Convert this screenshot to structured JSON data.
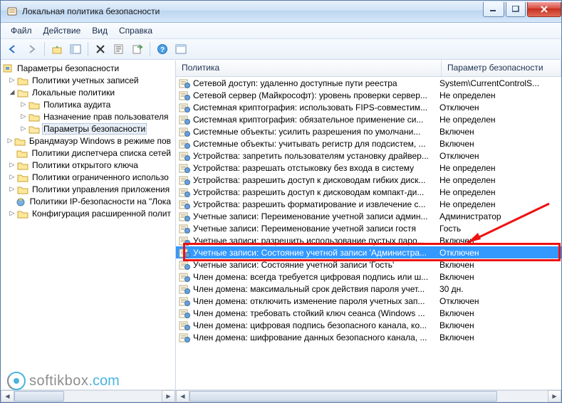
{
  "window": {
    "title": "Локальная политика безопасности"
  },
  "menu": {
    "file": "Файл",
    "action": "Действие",
    "view": "Вид",
    "help": "Справка"
  },
  "tree": {
    "root": "Параметры безопасности",
    "n1": "Политики учетных записей",
    "n2": "Локальные политики",
    "n2a": "Политика аудита",
    "n2b": "Назначение прав пользователя",
    "n2c": "Параметры безопасности",
    "n3": "Брандмауэр Windows в режиме пов",
    "n4": "Политики диспетчера списка сетей",
    "n5": "Политики открытого ключа",
    "n6": "Политики ограниченного использо",
    "n7": "Политики управления приложения",
    "n8": "Политики IP-безопасности на \"Лока",
    "n9": "Конфигурация расширенной полит"
  },
  "columns": {
    "policy": "Политика",
    "setting": "Параметр безопасности"
  },
  "rows": [
    {
      "p": "Сетевой доступ: удаленно доступные пути реестра",
      "s": "System\\CurrentControlS..."
    },
    {
      "p": "Сетевой сервер (Майкрософт): уровень проверки сервер...",
      "s": "Не определен"
    },
    {
      "p": "Системная криптография: использовать FIPS-совместим...",
      "s": "Отключен"
    },
    {
      "p": "Системная криптография: обязательное применение си...",
      "s": "Не определен"
    },
    {
      "p": "Системные объекты: усилить разрешения по умолчани...",
      "s": "Включен"
    },
    {
      "p": "Системные объекты: учитывать регистр для подсистем, ...",
      "s": "Включен"
    },
    {
      "p": "Устройства: запретить пользователям установку драйвер...",
      "s": "Отключен"
    },
    {
      "p": "Устройства: разрешать отстыковку без входа в систему",
      "s": "Не определен"
    },
    {
      "p": "Устройства: разрешить доступ к дисководам гибких диск...",
      "s": "Не определен"
    },
    {
      "p": "Устройства: разрешить доступ к дисководам компакт-ди...",
      "s": "Не определен"
    },
    {
      "p": "Устройства: разрешить форматирование и извлечение с...",
      "s": "Не определен"
    },
    {
      "p": "Учетные записи: Переименование учетной записи админ...",
      "s": "Администратор"
    },
    {
      "p": "Учетные записи: Переименование учетной записи гостя",
      "s": "Гость"
    },
    {
      "p": "Учетные записи: разрешить использование пустых паро...",
      "s": "Включен"
    },
    {
      "p": "Учетные записи: Состояние учетной записи 'Администра...",
      "s": "Отключен",
      "sel": true
    },
    {
      "p": "Учетные записи: Состояние учетной записи 'Гость'",
      "s": "Включен"
    },
    {
      "p": "Член домена: всегда требуется цифровая подпись или ш...",
      "s": "Включен"
    },
    {
      "p": "Член домена: максимальный срок действия пароля учет...",
      "s": "30 дн."
    },
    {
      "p": "Член домена: отключить изменение пароля учетных зап...",
      "s": "Отключен"
    },
    {
      "p": "Член домена: требовать стойкий ключ сеанса (Windows ...",
      "s": "Включен"
    },
    {
      "p": "Член домена: цифровая подпись безопасного канала, ко...",
      "s": "Включен"
    },
    {
      "p": "Член домена: шифрование данных безопасного канала, ...",
      "s": "Включен"
    }
  ],
  "watermark": {
    "a": "softikbox",
    "b": ".com"
  }
}
